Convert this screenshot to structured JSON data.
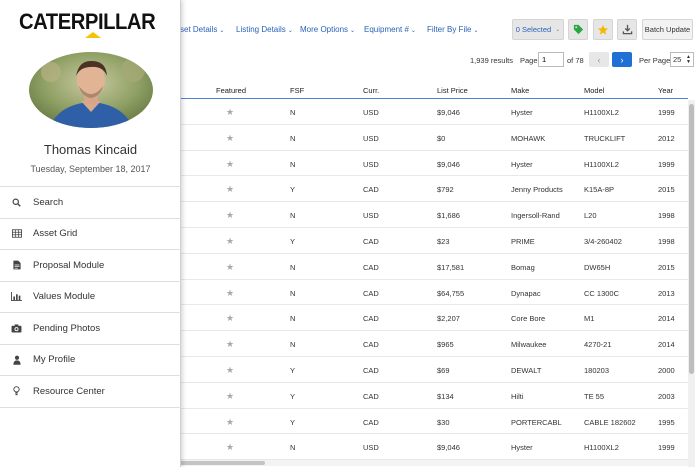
{
  "filters": {
    "asset_details": "sset Details",
    "listing_details": "Listing Details",
    "more_options": "More Options",
    "equipment_num": "Equipment #",
    "filter_by_file": "Filter By File"
  },
  "toolbar": {
    "selected_label": "0 Selected",
    "batch_update_label": "Batch Update",
    "tag_icon": "tag-icon",
    "star_icon": "star-icon",
    "download_icon": "download-icon",
    "tag_color": "#27a843",
    "star_color": "#f5b800"
  },
  "pagination": {
    "results": "1,939 results",
    "page_label": "Page",
    "page_value": "1",
    "of_label": "of 78",
    "per_page_label": "Per Page",
    "per_page_value": "25"
  },
  "table": {
    "headers": {
      "featured": "Featured",
      "fsf": "FSF",
      "curr": "Curr.",
      "price": "List Price",
      "make": "Make",
      "model": "Model",
      "year": "Year"
    },
    "rows": [
      {
        "star": "★",
        "fsf": "N",
        "curr": "USD",
        "price": "$9,046",
        "make": "Hyster",
        "model": "H1100XL2",
        "year": "1999"
      },
      {
        "star": "★",
        "fsf": "N",
        "curr": "USD",
        "price": "$0",
        "make": "MOHAWK",
        "model": "TRUCKLIFT",
        "year": "2012"
      },
      {
        "star": "★",
        "fsf": "N",
        "curr": "USD",
        "price": "$9,046",
        "make": "Hyster",
        "model": "H1100XL2",
        "year": "1999"
      },
      {
        "star": "★",
        "fsf": "Y",
        "curr": "CAD",
        "price": "$792",
        "make": "Jenny Products",
        "model": "K15A-8P",
        "year": "2015"
      },
      {
        "star": "★",
        "fsf": "N",
        "curr": "USD",
        "price": "$1,686",
        "make": "Ingersoll-Rand",
        "model": "L20",
        "year": "1998"
      },
      {
        "star": "★",
        "fsf": "Y",
        "curr": "CAD",
        "price": "$23",
        "make": "PRIME",
        "model": "3/4-260402",
        "year": "1998"
      },
      {
        "star": "★",
        "fsf": "N",
        "curr": "CAD",
        "price": "$17,581",
        "make": "Bomag",
        "model": "DW65H",
        "year": "2015"
      },
      {
        "star": "★",
        "fsf": "N",
        "curr": "CAD",
        "price": "$64,755",
        "make": "Dynapac",
        "model": "CC 1300C",
        "year": "2013"
      },
      {
        "star": "★",
        "fsf": "N",
        "curr": "CAD",
        "price": "$2,207",
        "make": "Core Bore",
        "model": "M1",
        "year": "2014"
      },
      {
        "star": "★",
        "fsf": "N",
        "curr": "CAD",
        "price": "$965",
        "make": "Milwaukee",
        "model": "4270-21",
        "year": "2014"
      },
      {
        "star": "★",
        "fsf": "Y",
        "curr": "CAD",
        "price": "$69",
        "make": "DEWALT",
        "model": "180203",
        "year": "2000"
      },
      {
        "star": "★",
        "fsf": "Y",
        "curr": "CAD",
        "price": "$134",
        "make": "Hilti",
        "model": "TE 55",
        "year": "2003"
      },
      {
        "star": "★",
        "fsf": "Y",
        "curr": "CAD",
        "price": "$30",
        "make": "PORTERCABL",
        "model": "CABLE 182602",
        "year": "1995"
      },
      {
        "star": "★",
        "fsf": "N",
        "curr": "USD",
        "price": "$9,046",
        "make": "Hyster",
        "model": "H1100XL2",
        "year": "1999"
      }
    ]
  },
  "drawer": {
    "logo": "CATERPILLAR",
    "user_name": "Thomas Kincaid",
    "date": "Tuesday, September 18, 2017",
    "nav": [
      {
        "label": "Search",
        "icon": "search-icon"
      },
      {
        "label": "Asset Grid",
        "icon": "grid-icon"
      },
      {
        "label": "Proposal Module",
        "icon": "document-icon"
      },
      {
        "label": "Values Module",
        "icon": "bar-chart-icon"
      },
      {
        "label": "Pending Photos",
        "icon": "camera-icon"
      },
      {
        "label": "My Profile",
        "icon": "user-icon"
      },
      {
        "label": "Resource Center",
        "icon": "lightbulb-icon"
      }
    ]
  }
}
